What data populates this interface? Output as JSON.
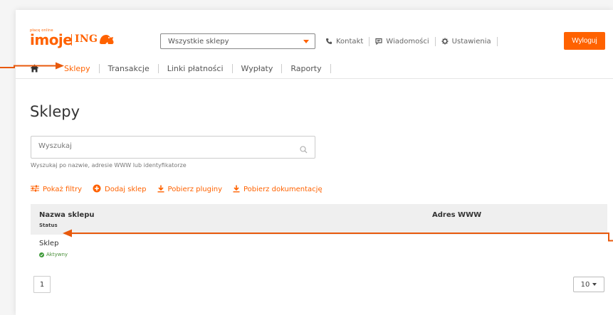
{
  "header": {
    "logo_small": "płacę online",
    "logo_main": "imoje",
    "logo_bank": "ING",
    "store_select": {
      "value": "Wszystkie sklepy"
    },
    "links": [
      {
        "label": "Kontakt",
        "icon": "phone-icon"
      },
      {
        "label": "Wiadomości",
        "icon": "message-icon"
      },
      {
        "label": "Ustawienia",
        "icon": "gear-icon"
      }
    ],
    "logout_label": "Wyloguj"
  },
  "nav": {
    "items": [
      {
        "label": "Sklepy",
        "active": true
      },
      {
        "label": "Transakcje"
      },
      {
        "label": "Linki płatności"
      },
      {
        "label": "Wypłaty"
      },
      {
        "label": "Raporty"
      }
    ]
  },
  "page": {
    "title": "Sklepy",
    "search": {
      "placeholder": "Wyszukaj",
      "hint": "Wyszukaj po nazwie, adresie WWW lub identyfikatorze"
    },
    "actions": [
      {
        "label": "Pokaż filtry",
        "icon": "filter-icon"
      },
      {
        "label": "Dodaj sklep",
        "icon": "plus-circle-icon"
      },
      {
        "label": "Pobierz pluginy",
        "icon": "download-icon"
      },
      {
        "label": "Pobierz dokumentację",
        "icon": "download-icon"
      }
    ]
  },
  "table": {
    "columns": {
      "name": "Nazwa sklepu",
      "status": "Status",
      "www": "Adres WWW"
    },
    "rows": [
      {
        "name": "Sklep",
        "status": "Aktywny",
        "www": ""
      }
    ]
  },
  "pagination": {
    "current_page": "1",
    "per_page": "10"
  },
  "colors": {
    "accent": "#ff6200",
    "success": "#3f9a3a",
    "annotation_arrow": "#e8590c"
  }
}
